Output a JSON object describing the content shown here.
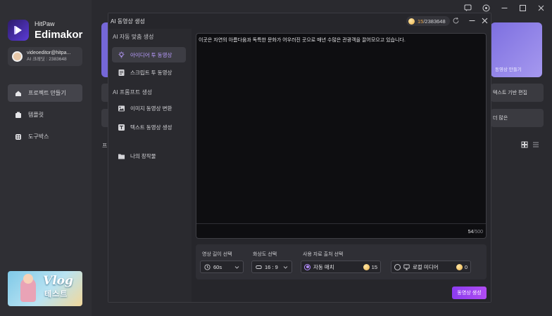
{
  "app": {
    "brand": "HitPaw",
    "product": "Edimakor",
    "user": {
      "email": "videoeditor@hitpa...",
      "credit_label": "AI 크레딧 : 2383648"
    },
    "nav": [
      {
        "label": "프로젝트 만들기",
        "icon": "home-icon",
        "active": true
      },
      {
        "label": "템플릿",
        "icon": "template-icon",
        "active": false
      },
      {
        "label": "도구박스",
        "icon": "toolbox-icon",
        "active": false
      }
    ],
    "promo": {
      "title": "Vlog",
      "subtitle": "테스트"
    },
    "background": {
      "card_label": "동영상 만들기",
      "row1_label": "텍스트 기반 편집",
      "row2_label": "더 많은",
      "section_letter": "프"
    }
  },
  "dialog": {
    "title": "AI 동영상 생성",
    "credits": {
      "used": "15",
      "total": "/2383648"
    },
    "sidebar": {
      "section1_title": "AI 자동 맞춤 생성",
      "section1_items": [
        {
          "label": "아이디어 투 동영상",
          "icon": "lightbulb-icon",
          "active": true
        },
        {
          "label": "스크립트 투 동영상",
          "icon": "script-icon",
          "active": false
        }
      ],
      "section2_title": "AI 프롬프트 생성",
      "section2_items": [
        {
          "label": "이미지 동영상 변환",
          "icon": "image-icon",
          "active": false
        },
        {
          "label": "텍스트 동영상 생성",
          "icon": "text-icon",
          "active": false
        }
      ],
      "my_works": {
        "label": "나의 창작물",
        "icon": "folder-icon"
      }
    },
    "prompt": {
      "text": "이곳은 자연의 아름다움과 독특한 문화가 어우러진 곳으로 매년 수많은 관광객을 끌어모으고 있습니다.",
      "count": "54",
      "max": "500",
      "separator": "/"
    },
    "options": {
      "length_label": "영상 길이 선택",
      "length_value": "60s",
      "ratio_label": "화상도 선택",
      "ratio_value": "16 : 9",
      "source_label": "사용 자료 출처 선택",
      "source_auto": {
        "label": "자동 매치",
        "cost": "15",
        "checked": true
      },
      "source_local": {
        "label": "로컬 미디어",
        "cost": "0",
        "checked": false
      }
    },
    "generate_label": "동영상 생성"
  },
  "colors": {
    "accent": "#b38cff",
    "generate_gradient_start": "#8b3cf0",
    "generate_gradient_end": "#b04cf2",
    "credit_highlight": "#e7a64a"
  }
}
